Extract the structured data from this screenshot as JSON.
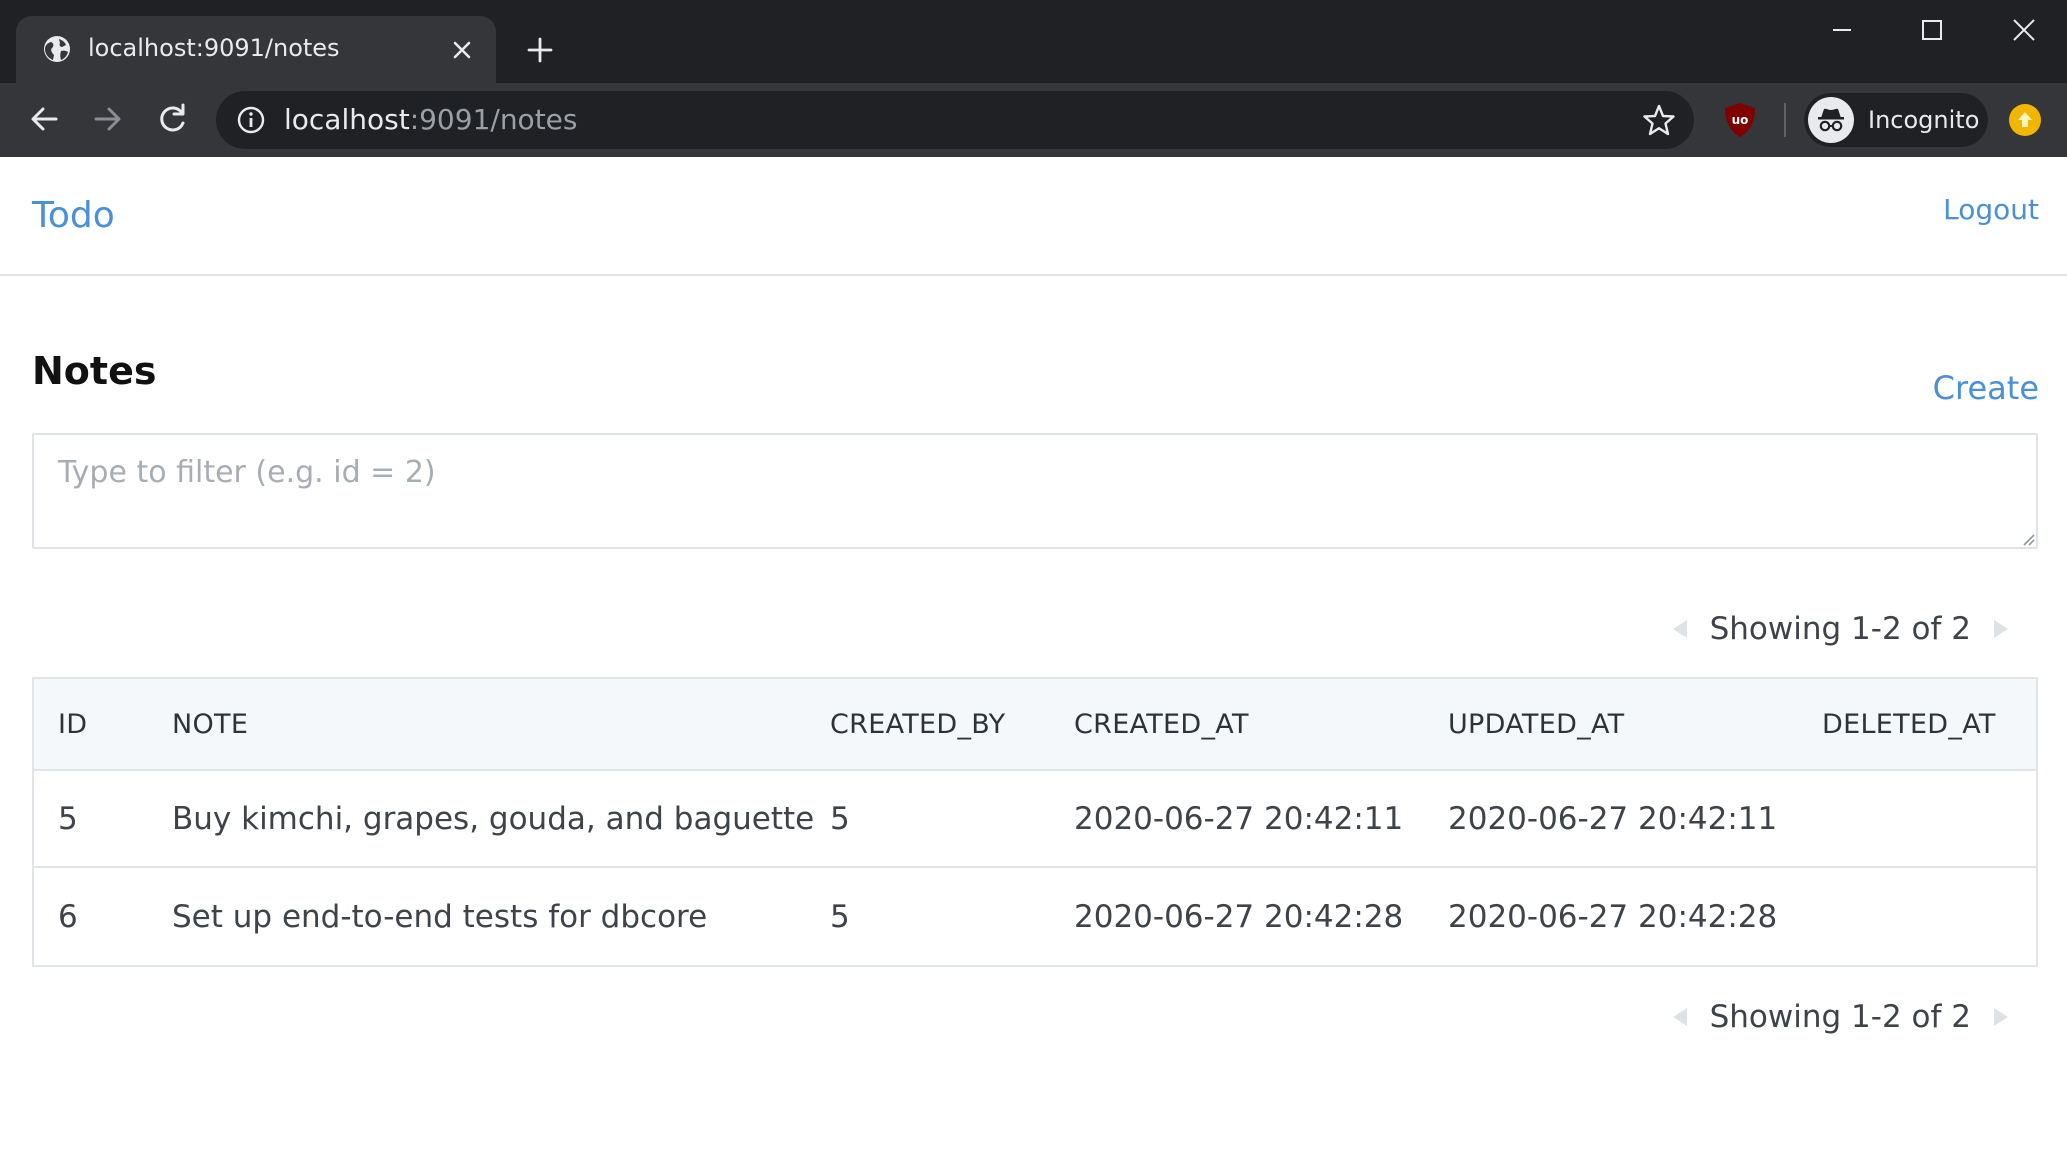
{
  "browser": {
    "tab_title": "localhost:9091/notes",
    "url_host": "localhost",
    "url_rest": ":9091/notes",
    "profile_label": "Incognito",
    "colors": {
      "chrome_dark": "#202124",
      "chrome_mid": "#35363a",
      "ublock_red": "#800000",
      "profile_yellow": "#f2b600"
    }
  },
  "app": {
    "brand": "Todo",
    "logout_label": "Logout",
    "page_title": "Notes",
    "create_label": "Create",
    "filter_placeholder": "Type to filter (e.g. id = 2)",
    "filter_value": "",
    "pager_text": "Showing 1-2 of 2",
    "accent_color": "#4a90d9"
  },
  "table": {
    "columns": [
      "ID",
      "NOTE",
      "CREATED_BY",
      "CREATED_AT",
      "UPDATED_AT",
      "DELETED_AT"
    ],
    "rows": [
      {
        "id": "5",
        "note": "Buy kimchi, grapes, gouda, and baguette",
        "created_by": "5",
        "created_at": "2020-06-27 20:42:11",
        "updated_at": "2020-06-27 20:42:11",
        "deleted_at": ""
      },
      {
        "id": "6",
        "note": "Set up end-to-end tests for dbcore",
        "created_by": "5",
        "created_at": "2020-06-27 20:42:28",
        "updated_at": "2020-06-27 20:42:28",
        "deleted_at": ""
      }
    ]
  },
  "icons": {
    "tab_favicon": "globe-icon",
    "tab_close": "close-icon",
    "new_tab": "plus-icon",
    "back": "arrow-left-icon",
    "forward": "arrow-right-icon",
    "reload": "reload-icon",
    "site_info": "info-icon",
    "bookmark": "star-icon",
    "extension": "ublock-origin-icon",
    "incognito": "incognito-icon",
    "profile": "profile-icon",
    "pager_prev": "triangle-left-icon",
    "pager_next": "triangle-right-icon"
  }
}
